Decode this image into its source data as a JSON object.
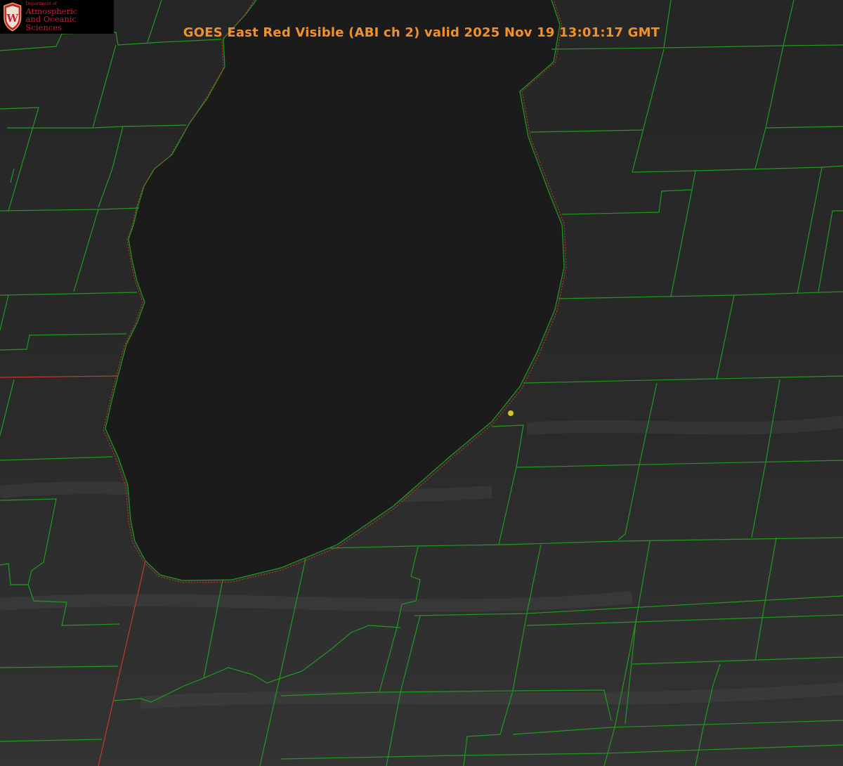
{
  "title": "GOES East Red Visible (ABI ch 2) valid 2025 Nov 19 13:01:17 GMT",
  "logo": {
    "department": "Department of",
    "line1": "Atmospheric",
    "line2": "and Oceanic Sciences",
    "crest_letter": "W"
  },
  "colors": {
    "background": "#222222",
    "lake": "#1b1b1b",
    "county_lines": "#1f9a1f",
    "state_line": "#c43a2a",
    "title": "#f0912a",
    "logo_text": "#c8203a",
    "marker": "#d4c424"
  },
  "map": {
    "features": [
      "lake",
      "county-boundaries",
      "state-boundary",
      "point-marker"
    ]
  }
}
